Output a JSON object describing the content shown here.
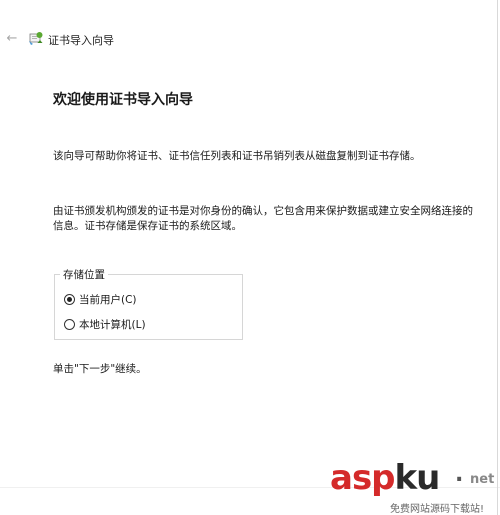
{
  "window": {
    "title": "证书导入向导",
    "back_glyph": "←"
  },
  "main": {
    "heading": "欢迎使用证书导入向导",
    "paragraph1": "该向导可帮助你将证书、证书信任列表和证书吊销列表从磁盘复制到证书存储。",
    "paragraph2": "由证书颁发机构颁发的证书是对你身份的确认，它包含用来保护数据或建立安全网络连接的信息。证书存储是保存证书的系统区域。",
    "store_location": {
      "label": "存储位置",
      "options": [
        {
          "label": "当前用户(C)",
          "selected": true
        },
        {
          "label": "本地计算机(L)",
          "selected": false
        }
      ]
    },
    "continue_text": "单击\"下一步\"继续。"
  },
  "watermark": {
    "brand_asp": "asp",
    "brand_ku": "ku",
    "dot": ".",
    "tld": "net",
    "subtitle": "免费网站源码下载站!"
  },
  "colors": {
    "watermark_red": "#d42a2a",
    "radio_selected": "#222222"
  }
}
